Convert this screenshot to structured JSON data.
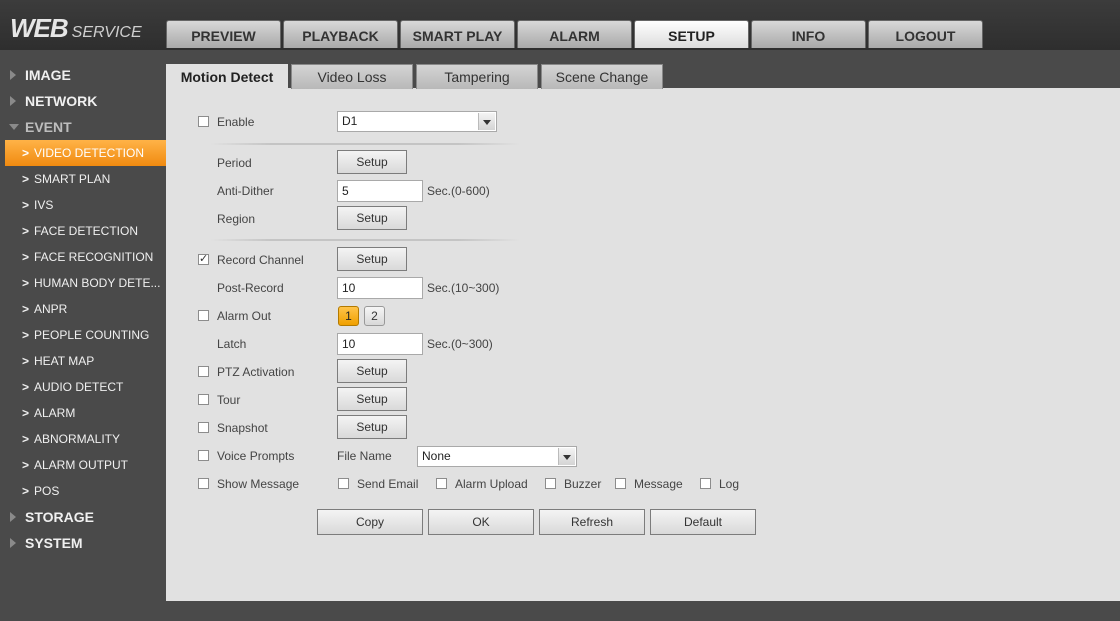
{
  "brand": {
    "main": "WEB",
    "sub": "SERVICE"
  },
  "top_tabs": [
    "PREVIEW",
    "PLAYBACK",
    "SMART PLAY",
    "ALARM",
    "SETUP",
    "INFO",
    "LOGOUT"
  ],
  "sidebar": {
    "image": "IMAGE",
    "network": "NETWORK",
    "event": "EVENT",
    "event_items": [
      "VIDEO DETECTION",
      "SMART PLAN",
      "IVS",
      "FACE DETECTION",
      "FACE RECOGNITION",
      "HUMAN BODY DETE...",
      "ANPR",
      "PEOPLE COUNTING",
      "HEAT MAP",
      "AUDIO DETECT",
      "ALARM",
      "ABNORMALITY",
      "ALARM OUTPUT",
      "POS"
    ],
    "storage": "STORAGE",
    "system": "SYSTEM",
    "chevron": ">"
  },
  "sub_tabs": [
    "Motion Detect",
    "Video Loss",
    "Tampering",
    "Scene Change"
  ],
  "form": {
    "enable_label": "Enable",
    "channel_value": "D1",
    "period_label": "Period",
    "anti_dither_label": "Anti-Dither",
    "anti_dither_value": "5",
    "anti_dither_unit": "Sec.(0-600)",
    "region_label": "Region",
    "record_channel_label": "Record Channel",
    "record_channel_check": "✓",
    "post_record_label": "Post-Record",
    "post_record_value": "10",
    "post_record_unit": "Sec.(10~300)",
    "alarm_out_label": "Alarm Out",
    "alarm_out_1": "1",
    "alarm_out_2": "2",
    "latch_label": "Latch",
    "latch_value": "10",
    "latch_unit": "Sec.(0~300)",
    "ptz_label": "PTZ Activation",
    "tour_label": "Tour",
    "snapshot_label": "Snapshot",
    "voice_label": "Voice Prompts",
    "file_name_label": "File Name",
    "file_name_value": "None",
    "show_message_label": "Show Message",
    "send_email_label": "Send Email",
    "alarm_upload_label": "Alarm Upload",
    "buzzer_label": "Buzzer",
    "message_label": "Message",
    "log_label": "Log",
    "setup_label": "Setup"
  },
  "actions": {
    "copy": "Copy",
    "ok": "OK",
    "refresh": "Refresh",
    "default": "Default"
  },
  "colors": {
    "accent": "#f59a1c",
    "background": "#e1e1e1",
    "sidebar": "#4a4a4a"
  }
}
